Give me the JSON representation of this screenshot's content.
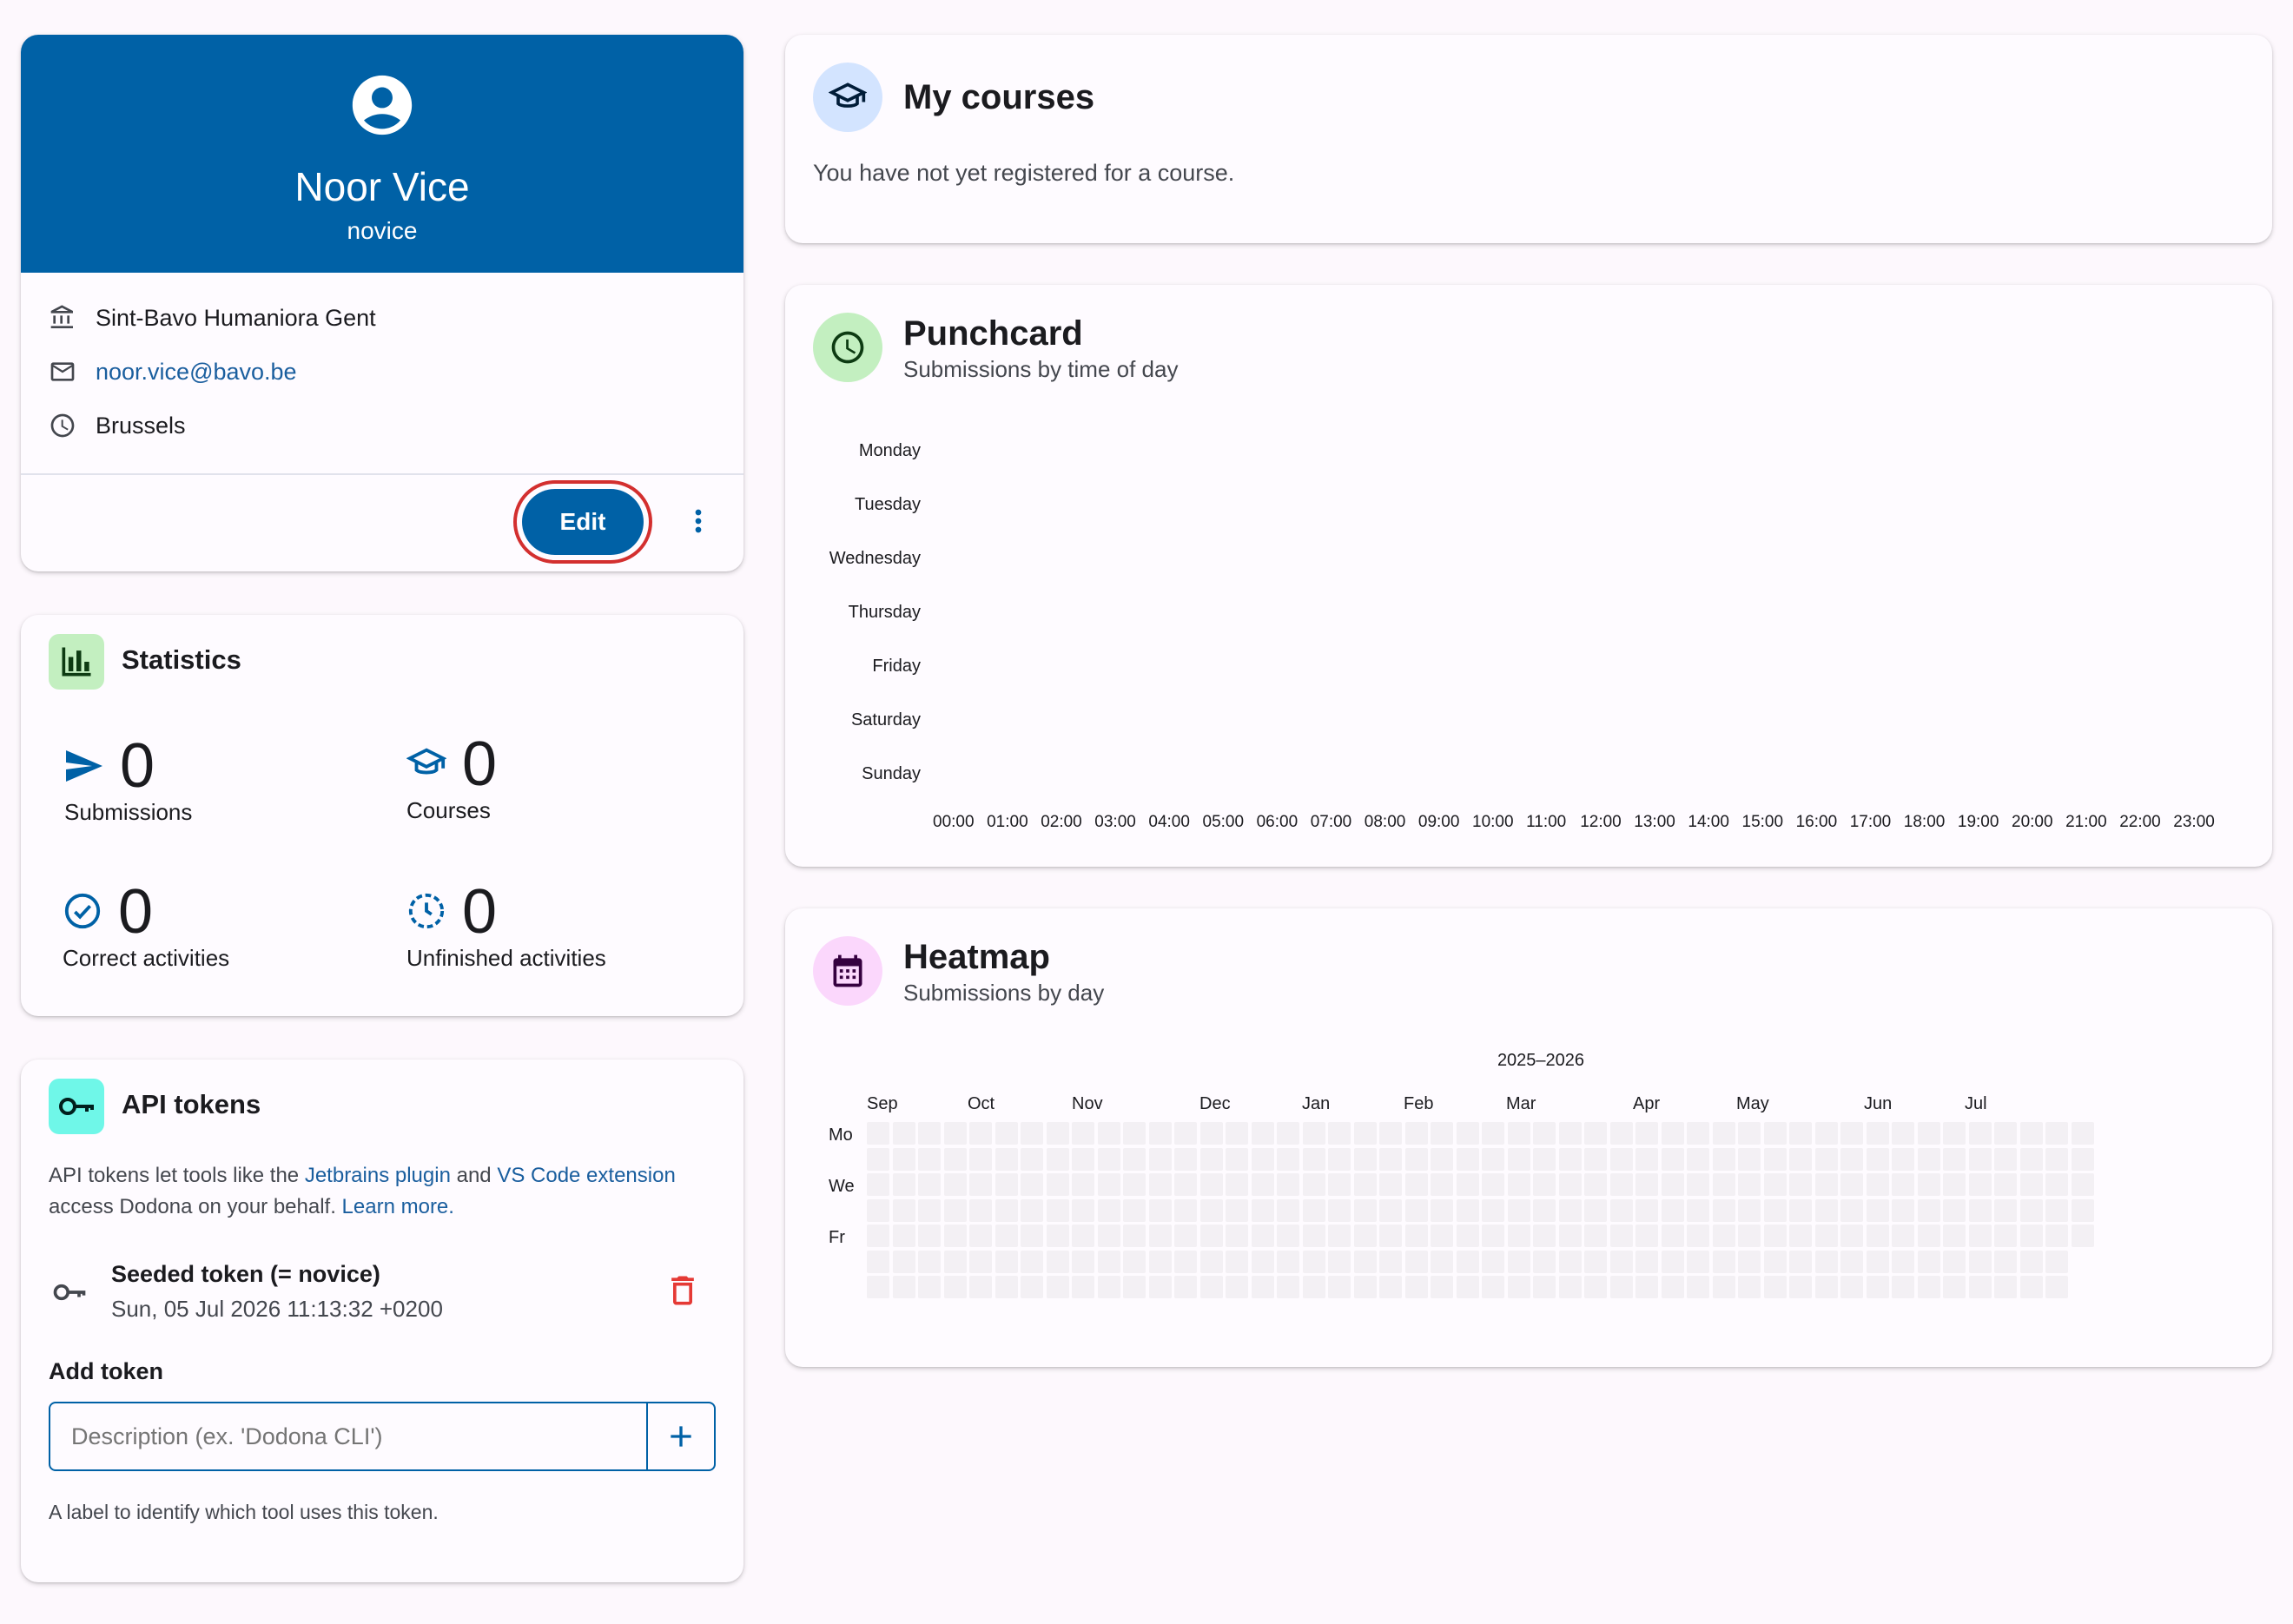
{
  "profile": {
    "name": "Noor Vice",
    "username": "novice",
    "institution": "Sint-Bavo Humaniora Gent",
    "email": "noor.vice@bavo.be",
    "timezone": "Brussels",
    "edit_label": "Edit"
  },
  "statistics": {
    "title": "Statistics",
    "items": [
      {
        "value": "0",
        "label": "Submissions",
        "icon": "send-icon"
      },
      {
        "value": "0",
        "label": "Courses",
        "icon": "school-icon"
      },
      {
        "value": "0",
        "label": "Correct activities",
        "icon": "check-circle-icon"
      },
      {
        "value": "0",
        "label": "Unfinished activities",
        "icon": "clock-dashed-icon"
      }
    ]
  },
  "api_tokens": {
    "title": "API tokens",
    "desc_prefix": "API tokens let tools like the ",
    "link_jetbrains": "Jetbrains plugin",
    "desc_and": " and ",
    "link_vscode": "VS Code extension",
    "desc_line2": "access Dodona on your behalf. ",
    "link_learn": "Learn more.",
    "token_name": "Seeded token (= novice)",
    "token_date": "Sun, 05 Jul 2026 11:13:32 +0200",
    "add_title": "Add token",
    "input_placeholder": "Description (ex. 'Dodona CLI')",
    "hint": "A label to identify which tool uses this token."
  },
  "courses": {
    "title": "My courses",
    "empty_text": "You have not yet registered for a course."
  },
  "punchcard": {
    "title": "Punchcard",
    "subtitle": "Submissions by time of day",
    "days": [
      "Monday",
      "Tuesday",
      "Wednesday",
      "Thursday",
      "Friday",
      "Saturday",
      "Sunday"
    ],
    "hours": [
      "00:00",
      "01:00",
      "02:00",
      "03:00",
      "04:00",
      "05:00",
      "06:00",
      "07:00",
      "08:00",
      "09:00",
      "10:00",
      "11:00",
      "12:00",
      "13:00",
      "14:00",
      "15:00",
      "16:00",
      "17:00",
      "18:00",
      "19:00",
      "20:00",
      "21:00",
      "22:00",
      "23:00"
    ]
  },
  "heatmap": {
    "title": "Heatmap",
    "subtitle": "Submissions by day",
    "year_label": "2025–2026",
    "months": [
      "Sep",
      "Oct",
      "Nov",
      "Dec",
      "Jan",
      "Feb",
      "Mar",
      "Apr",
      "May",
      "Jun",
      "Jul"
    ],
    "day_labels": [
      "Mo",
      "We",
      "Fr"
    ],
    "weeks": 48,
    "values": "all zero (no submissions)"
  },
  "colors": {
    "primary": "#0061a6",
    "edit_highlight": "#d32f2f",
    "delete": "#e53935",
    "stats_icon_bg": "#c3efc0",
    "punchcard_icon_bg": "#c3efc0",
    "courses_icon_bg": "#d3e4ff",
    "heatmap_icon_bg": "#fbd7fc",
    "api_icon_bg": "#6ff7e8",
    "heat_cell": "#f3f0f4"
  }
}
